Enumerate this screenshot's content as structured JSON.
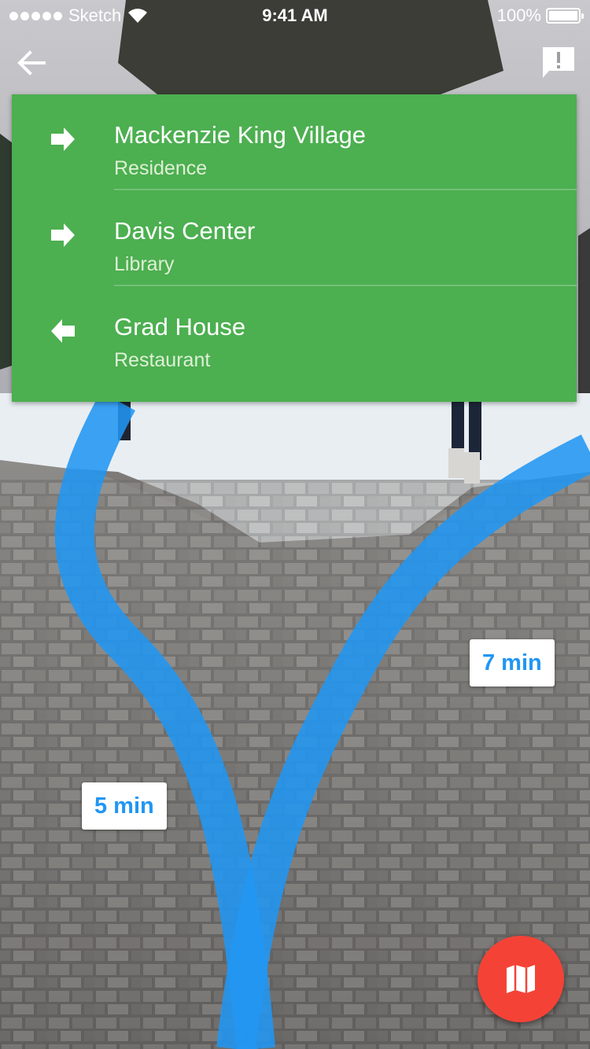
{
  "status_bar": {
    "carrier": "Sketch",
    "time": "9:41 AM",
    "battery": "100%"
  },
  "toolbar": {
    "back_icon": "arrow-back-icon",
    "feedback_icon": "feedback-icon"
  },
  "destinations": [
    {
      "name": "Mackenzie King Village",
      "type": "Residence",
      "direction_icon": "arrow-right-icon"
    },
    {
      "name": "Davis Center",
      "type": "Library",
      "direction_icon": "arrow-right-icon"
    },
    {
      "name": "Grad House",
      "type": "Restaurant",
      "direction_icon": "arrow-left-icon"
    }
  ],
  "routes": [
    {
      "label": "7 min"
    },
    {
      "label": "5 min"
    }
  ],
  "fab": {
    "icon": "map-icon"
  },
  "colors": {
    "card_green": "#4caf50",
    "route_blue": "#2196f3",
    "fab_red": "#f44336",
    "chip_text_blue": "#2196f3"
  }
}
